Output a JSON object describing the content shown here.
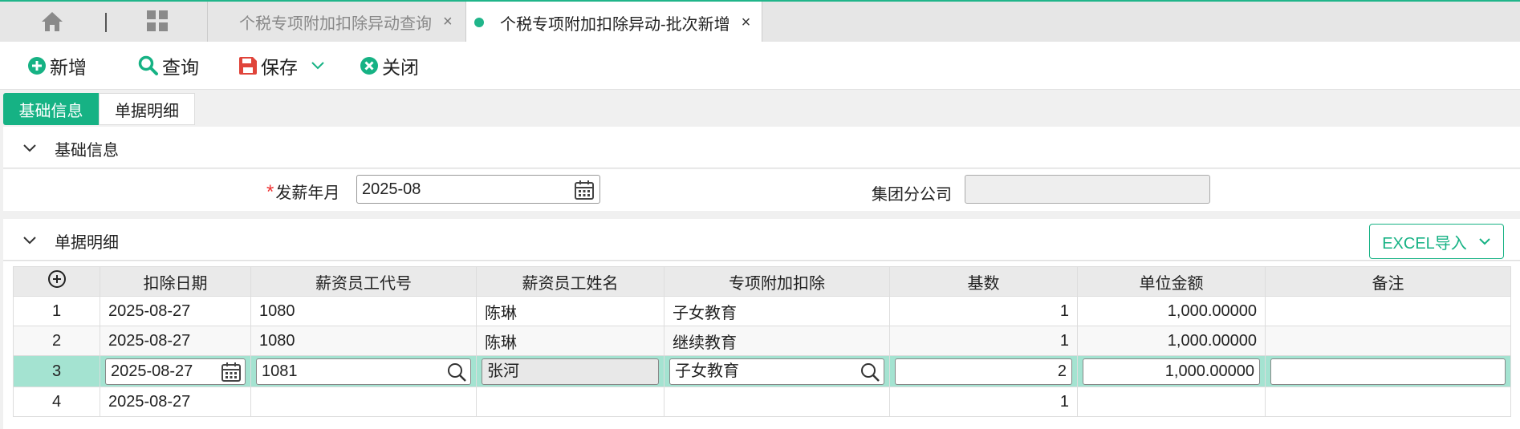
{
  "topbar": {
    "tabs": [
      {
        "label": "个税专项附加扣除异动查询",
        "close": "×"
      },
      {
        "label": "个税专项附加扣除异动-批次新增",
        "close": "×"
      }
    ]
  },
  "toolbar": {
    "add_label": "新增",
    "query_label": "查询",
    "save_label": "保存",
    "close_label": "关闭"
  },
  "subtabs": [
    "基础信息",
    "单据明细"
  ],
  "basic_section": {
    "title": "基础信息",
    "month_required": "*",
    "month_label": "发薪年月",
    "month_value": "2025-08",
    "group_label": "集团分公司",
    "group_value": ""
  },
  "detail_section": {
    "title": "单据明细",
    "excel_label": "EXCEL导入"
  },
  "table": {
    "headers": [
      "扣除日期",
      "薪资员工代号",
      "薪资员工姓名",
      "专项附加扣除",
      "基数",
      "单位金额",
      "备注"
    ],
    "rows": [
      {
        "no": "1",
        "date": "2025-08-27",
        "code": "1080",
        "name": "陈琳",
        "item": "子女教育",
        "base": "1",
        "amount": "1,000.00000",
        "remark": ""
      },
      {
        "no": "2",
        "date": "2025-08-27",
        "code": "1080",
        "name": "陈琳",
        "item": "继续教育",
        "base": "1",
        "amount": "1,000.00000",
        "remark": ""
      },
      {
        "no": "3",
        "date": "2025-08-27",
        "code": "1081",
        "name": "张河",
        "item": "子女教育",
        "base": "2",
        "amount": "1,000.00000",
        "remark": ""
      },
      {
        "no": "4",
        "date": "2025-08-27",
        "code": "",
        "name": "",
        "item": "",
        "base": "1",
        "amount": "",
        "remark": ""
      }
    ]
  },
  "colors": {
    "accent": "#16b284",
    "selected_row": "#a4e3d1",
    "required": "#ee3333",
    "save_icon": "#e0443a"
  }
}
